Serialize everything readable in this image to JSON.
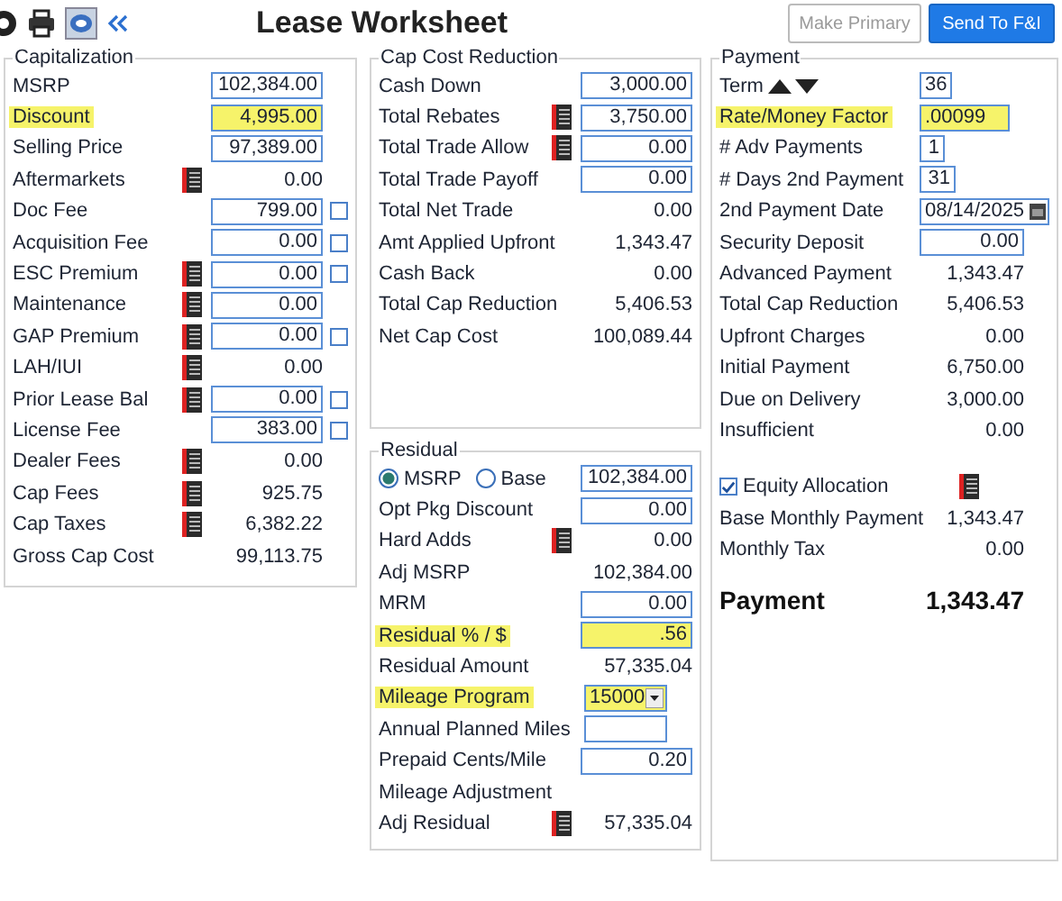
{
  "header": {
    "title": "Lease Worksheet",
    "buttons": [
      {
        "label": "Make Primary",
        "disabled": true,
        "primary": false
      },
      {
        "label": "Send To F&I",
        "disabled": false,
        "primary": true
      }
    ]
  },
  "capitalization": {
    "title": "Capitalization",
    "rows": [
      {
        "label": "MSRP",
        "kind": "input",
        "value": "102,384.00"
      },
      {
        "label": "Discount",
        "kind": "input",
        "value": "4,995.00",
        "highlighted": true
      },
      {
        "label": "Selling Price",
        "kind": "input",
        "value": "97,389.00"
      },
      {
        "label": "Aftermarkets",
        "kind": "value",
        "value": "0.00",
        "list_icon": true
      },
      {
        "label": "Doc Fee",
        "kind": "input",
        "value": "799.00",
        "checkbox": {
          "checked": false
        }
      },
      {
        "label": "Acquisition Fee",
        "kind": "input",
        "value": "0.00",
        "checkbox": {
          "checked": false
        }
      },
      {
        "label": "ESC Premium",
        "kind": "input",
        "value": "0.00",
        "list_icon": true,
        "checkbox": {
          "checked": false
        }
      },
      {
        "label": "Maintenance",
        "kind": "input",
        "value": "0.00",
        "list_icon": true
      },
      {
        "label": "GAP Premium",
        "kind": "input",
        "value": "0.00",
        "list_icon": true,
        "checkbox": {
          "checked": false
        }
      },
      {
        "label": "LAH/IUI",
        "kind": "value",
        "value": "0.00",
        "list_icon": true
      },
      {
        "label": "Prior Lease Bal",
        "kind": "input",
        "value": "0.00",
        "list_icon": true,
        "checkbox": {
          "checked": false
        }
      },
      {
        "label": "License Fee",
        "kind": "input",
        "value": "383.00",
        "checkbox": {
          "checked": false
        }
      },
      {
        "label": "Dealer Fees",
        "kind": "value",
        "value": "0.00",
        "list_icon": true
      },
      {
        "label": "Cap Fees",
        "kind": "value",
        "value": "925.75",
        "list_icon": true
      },
      {
        "label": "Cap Taxes",
        "kind": "value",
        "value": "6,382.22",
        "list_icon": true
      },
      {
        "label": "Gross Cap Cost",
        "kind": "value",
        "value": "99,113.75"
      }
    ]
  },
  "cap_cost_reduction": {
    "title": "Cap Cost Reduction",
    "rows": [
      {
        "label": "Cash Down",
        "kind": "input",
        "value": "3,000.00"
      },
      {
        "label": "Total Rebates",
        "kind": "input",
        "value": "3,750.00",
        "list_icon": true
      },
      {
        "label": "Total Trade Allow",
        "kind": "input",
        "value": "0.00",
        "list_icon": true
      },
      {
        "label": "Total Trade Payoff",
        "kind": "input",
        "value": "0.00"
      },
      {
        "label": "Total Net Trade",
        "kind": "value",
        "value": "0.00"
      },
      {
        "label": "Amt Applied Upfront",
        "kind": "value",
        "value": "1,343.47"
      },
      {
        "label": "Cash Back",
        "kind": "value",
        "value": "0.00"
      },
      {
        "label": "Total Cap Reduction",
        "kind": "value",
        "value": "5,406.53"
      },
      {
        "label": "Net Cap Cost",
        "kind": "value",
        "value": "100,089.44"
      }
    ]
  },
  "residual": {
    "title": "Residual",
    "rows": [
      {
        "kind": "radio",
        "options": [
          {
            "label": "MSRP",
            "selected": true
          },
          {
            "label": "Base",
            "selected": false
          }
        ],
        "value": "102,384.00"
      },
      {
        "label": "Opt Pkg Discount",
        "kind": "input",
        "value": "0.00"
      },
      {
        "label": "Hard Adds",
        "kind": "value",
        "value": "0.00",
        "list_icon": true
      },
      {
        "label": "Adj MSRP",
        "kind": "value",
        "value": "102,384.00"
      },
      {
        "label": "MRM",
        "kind": "input",
        "value": "0.00"
      },
      {
        "label": "Residual % / $",
        "kind": "input",
        "value": ".56",
        "highlighted": true
      },
      {
        "label": "Residual Amount",
        "kind": "value",
        "value": "57,335.04"
      },
      {
        "label": "Mileage Program",
        "kind": "select",
        "value": "15000",
        "highlighted": true
      },
      {
        "label": "Annual Planned Miles",
        "kind": "input"
      },
      {
        "label": "Prepaid Cents/Mile",
        "kind": "input",
        "value": "0.20"
      },
      {
        "label": "Mileage Adjustment",
        "kind": "text"
      },
      {
        "label": "Adj Residual",
        "kind": "value",
        "value": "57,335.04",
        "list_icon": true
      }
    ]
  },
  "payment": {
    "title": "Payment",
    "rows": [
      {
        "label": "Term",
        "kind": "spinner",
        "value": "36"
      },
      {
        "label": "Rate/Money Factor",
        "kind": "input",
        "value": ".00099",
        "highlighted": true
      },
      {
        "label": "# Adv Payments",
        "kind": "input",
        "value": "1"
      },
      {
        "label": "# Days 2nd Payment",
        "kind": "input",
        "value": "31"
      },
      {
        "label": "2nd Payment Date",
        "kind": "date",
        "value": "08/14/2025"
      },
      {
        "label": "Security Deposit",
        "kind": "input",
        "value": "0.00"
      },
      {
        "label": "Advanced Payment",
        "kind": "value",
        "value": "1,343.47"
      },
      {
        "label": "Total Cap Reduction",
        "kind": "value",
        "value": "5,406.53"
      },
      {
        "label": "Upfront Charges",
        "kind": "value",
        "value": "0.00"
      },
      {
        "label": "Initial Payment",
        "kind": "value",
        "value": "6,750.00"
      },
      {
        "label": "Due on Delivery",
        "kind": "value",
        "value": "3,000.00"
      },
      {
        "label": "Insufficient",
        "kind": "value",
        "value": "0.00"
      },
      {
        "label": "Equity Allocation",
        "kind": "checkbox",
        "checked": true,
        "list_icon": true
      },
      {
        "label": "Base Monthly Payment",
        "kind": "value",
        "value": "1,343.47"
      },
      {
        "label": "Monthly Tax",
        "kind": "value",
        "value": "0.00"
      }
    ],
    "total": {
      "label": "Payment",
      "value": "1,343.47"
    }
  }
}
